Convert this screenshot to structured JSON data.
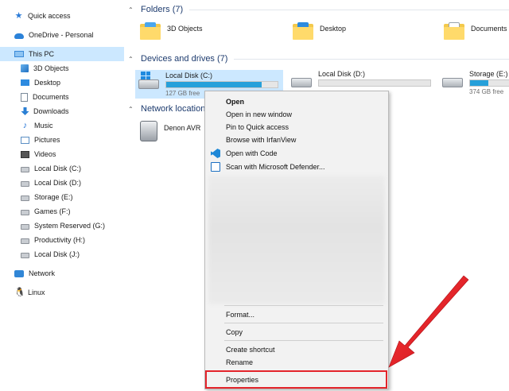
{
  "sidebar": {
    "items": [
      {
        "label": "Quick access",
        "icon": "star-icon"
      },
      {
        "label": "OneDrive - Personal",
        "icon": "cloud-icon"
      },
      {
        "label": "This PC",
        "icon": "computer-icon",
        "selected": true
      },
      {
        "label": "3D Objects",
        "icon": "cube-icon"
      },
      {
        "label": "Desktop",
        "icon": "desktop-icon"
      },
      {
        "label": "Documents",
        "icon": "document-icon"
      },
      {
        "label": "Downloads",
        "icon": "download-icon"
      },
      {
        "label": "Music",
        "icon": "music-icon"
      },
      {
        "label": "Pictures",
        "icon": "picture-icon"
      },
      {
        "label": "Videos",
        "icon": "video-icon"
      },
      {
        "label": "Local Disk (C:)",
        "icon": "drive-icon"
      },
      {
        "label": "Local Disk (D:)",
        "icon": "drive-icon"
      },
      {
        "label": "Storage (E:)",
        "icon": "drive-icon"
      },
      {
        "label": "Games (F:)",
        "icon": "drive-icon"
      },
      {
        "label": "System Reserved (G:)",
        "icon": "drive-icon"
      },
      {
        "label": "Productivity (H:)",
        "icon": "drive-icon"
      },
      {
        "label": "Local Disk (J:)",
        "icon": "drive-icon"
      },
      {
        "label": "Network",
        "icon": "network-icon"
      },
      {
        "label": "Linux",
        "icon": "linux-icon"
      }
    ]
  },
  "main": {
    "folders_header": "Folders (7)",
    "folders": [
      {
        "label": "3D Objects"
      },
      {
        "label": "Desktop"
      },
      {
        "label": "Documents"
      }
    ],
    "drives_header": "Devices and drives (7)",
    "drives": [
      {
        "name": "Local Disk (C:)",
        "free": "127 GB free",
        "used_fraction": 0.86
      },
      {
        "name": "Local Disk (D:)",
        "free": "",
        "used_fraction": 0.0
      },
      {
        "name": "Storage (E:)",
        "free": "374 GB free",
        "used_fraction": 0.3
      }
    ],
    "network_header": "Network location",
    "network_items": [
      {
        "label": "Denon AVR"
      }
    ]
  },
  "context_menu": {
    "items": [
      {
        "label": "Open",
        "bold": true
      },
      {
        "label": "Open in new window"
      },
      {
        "label": "Pin to Quick access"
      },
      {
        "label": "Browse with IrfanView"
      },
      {
        "label": "Open with Code",
        "icon": "vscode-icon"
      },
      {
        "label": "Scan with Microsoft Defender...",
        "icon": "defender-icon"
      },
      {
        "label": "Format..."
      },
      {
        "label": "Copy"
      },
      {
        "label": "Create shortcut"
      },
      {
        "label": "Rename"
      },
      {
        "label": "Properties"
      }
    ]
  },
  "colors": {
    "accent": "#26a0da",
    "selection": "#cce8ff",
    "highlight_red": "#e3242b"
  }
}
